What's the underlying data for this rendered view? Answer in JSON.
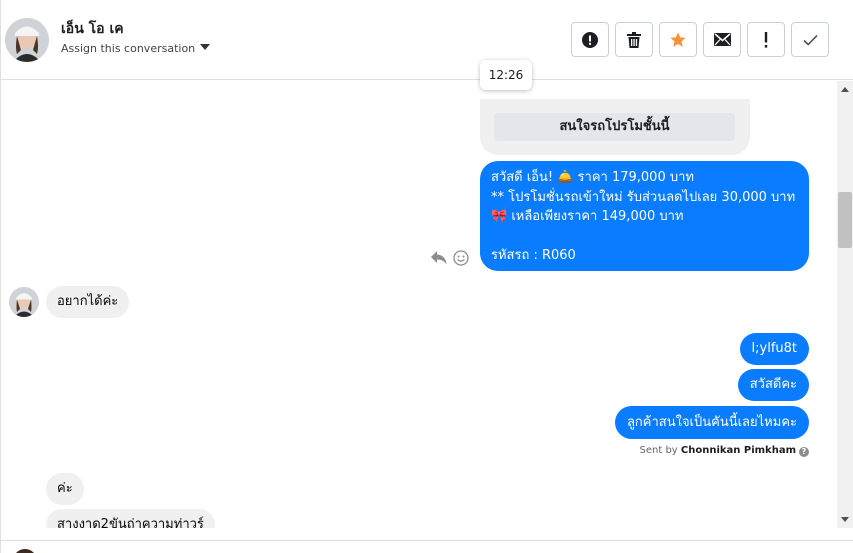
{
  "header": {
    "name": "เอ็น โอ เค",
    "assign_label": "Assign this conversation",
    "toolbar": [
      {
        "id": "spam",
        "icon": "alert-circle-icon"
      },
      {
        "id": "delete",
        "icon": "trash-icon"
      },
      {
        "id": "star",
        "icon": "star-icon",
        "color": "#f7923a"
      },
      {
        "id": "mail",
        "icon": "envelope-icon"
      },
      {
        "id": "important",
        "icon": "exclamation-icon"
      },
      {
        "id": "done",
        "icon": "checkmark-icon"
      }
    ]
  },
  "thread": {
    "tooltip_time": "12:26",
    "card_button": "สนใจรถโปรโมชั้นนี้",
    "promo_lines": [
      "สวัสดี เอ็น! 🛎️ ราคา 179,000 บาท",
      "** โปรโมชั่นรถเข้าใหม่ รับส่วนลดไปเลย 30,000 บาท",
      "🎀  เหลือเพียงราคา 149,000 บาท",
      "",
      " รหัสรถ : R060"
    ],
    "incoming_1": "อยากได้ค่ะ",
    "outgoing": [
      "l;ylfu8t",
      "สวัสดีคะ",
      "ลูกค้าสนใจเป็นคันนี้เลยไหมคะ"
    ],
    "sent_by_prefix": "Sent by",
    "sent_by_name": "Chonnikan Pimkham",
    "incoming_2": "ค่ะ",
    "incoming_3": "สางงาด2ขันถ่าความท่าวร์"
  },
  "colors": {
    "outgoing_bubble": "#0a7cff",
    "incoming_bubble": "#f0f0f0",
    "accent_star": "#f7923a"
  }
}
